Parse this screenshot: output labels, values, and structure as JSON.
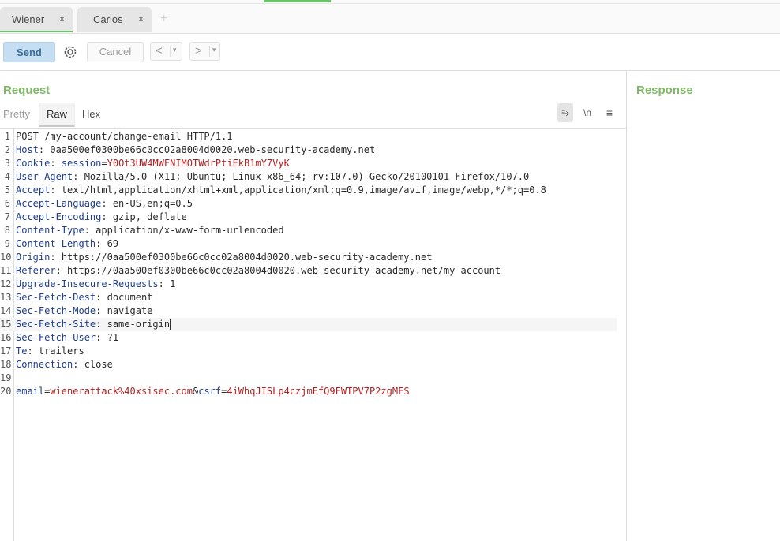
{
  "tabs": [
    {
      "label": "Wiener",
      "close": "×"
    },
    {
      "label": "Carlos",
      "close": "×"
    }
  ],
  "tab_add": "+",
  "toolbar": {
    "send": "Send",
    "cancel": "Cancel",
    "back": "<",
    "forward": ">",
    "dropdown": "▾"
  },
  "request": {
    "title": "Request",
    "view_tabs": [
      "Pretty",
      "Raw",
      "Hex"
    ],
    "icons": {
      "wrap": "⥱",
      "newline": "\\n",
      "menu": "≡"
    }
  },
  "response": {
    "title": "Response"
  },
  "lines": [
    {
      "n": "1",
      "text": "POST /my-account/change-email HTTP/1.1"
    },
    {
      "n": "2",
      "key": "Host",
      "val": "0aa500ef0300be66c0cc02a8004d0020.web-security-academy.net"
    },
    {
      "n": "3",
      "key": "Cookie",
      "ck": "session",
      "cv": "Y0Ot3UW4MWFNIMOTWdrPtiEkB1mY7VyK"
    },
    {
      "n": "4",
      "key": "User-Agent",
      "val": "Mozilla/5.0 (X11; Ubuntu; Linux x86_64; rv:107.0) Gecko/20100101 Firefox/107.0"
    },
    {
      "n": "5",
      "key": "Accept",
      "val": "text/html,application/xhtml+xml,application/xml;q=0.9,image/avif,image/webp,*/*;q=0.8"
    },
    {
      "n": "6",
      "key": "Accept-Language",
      "val": "en-US,en;q=0.5"
    },
    {
      "n": "7",
      "key": "Accept-Encoding",
      "val": "gzip, deflate"
    },
    {
      "n": "8",
      "key": "Content-Type",
      "val": "application/x-www-form-urlencoded"
    },
    {
      "n": "9",
      "key": "Content-Length",
      "val": "69"
    },
    {
      "n": "10",
      "key": "Origin",
      "val": "https://0aa500ef0300be66c0cc02a8004d0020.web-security-academy.net"
    },
    {
      "n": "11",
      "key": "Referer",
      "val": "https://0aa500ef0300be66c0cc02a8004d0020.web-security-academy.net/my-account"
    },
    {
      "n": "12",
      "key": "Upgrade-Insecure-Requests",
      "val": "1"
    },
    {
      "n": "13",
      "key": "Sec-Fetch-Dest",
      "val": "document"
    },
    {
      "n": "14",
      "key": "Sec-Fetch-Mode",
      "val": "navigate"
    },
    {
      "n": "15",
      "key": "Sec-Fetch-Site",
      "val": "same-origin"
    },
    {
      "n": "16",
      "key": "Sec-Fetch-User",
      "val": "?1"
    },
    {
      "n": "17",
      "key": "Te",
      "val": "trailers"
    },
    {
      "n": "18",
      "key": "Connection",
      "val": "close"
    },
    {
      "n": "19"
    },
    {
      "n": "20",
      "params": [
        {
          "k": "email",
          "v": "wienerattack%40xsisec.com"
        },
        {
          "k": "csrf",
          "v": "4iWhqJISLp4czjmEfQ9FWTPV7P2zgMFS"
        }
      ]
    }
  ]
}
